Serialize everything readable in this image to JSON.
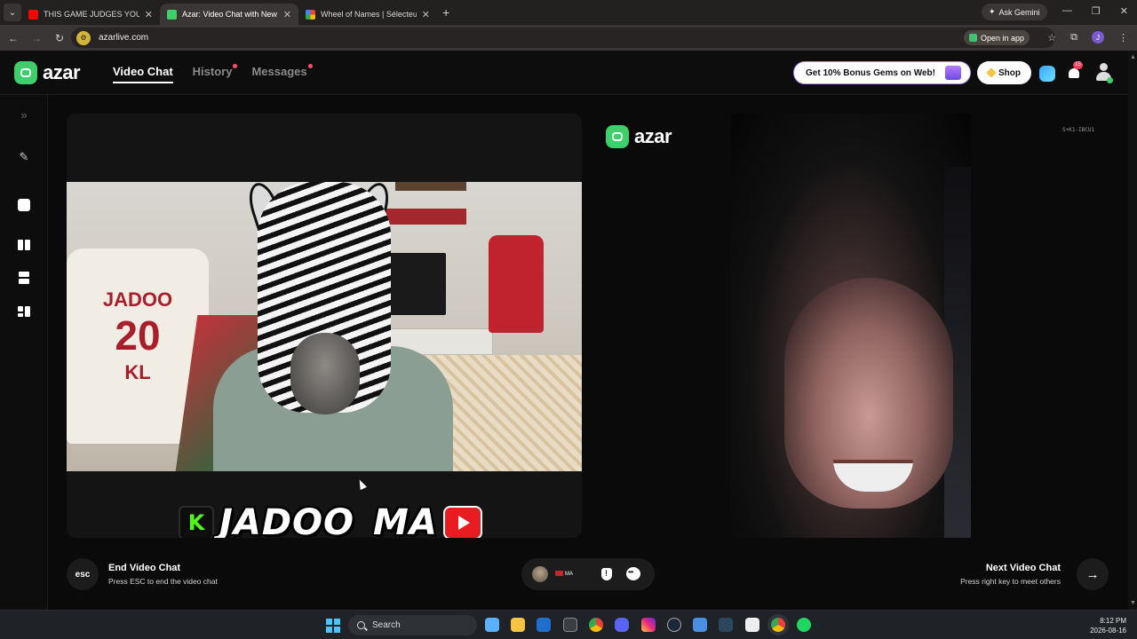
{
  "browser": {
    "tabs": [
      {
        "title": "THIS GAME JUDGES YOUR VOICE",
        "favicon_color": "#ff0000",
        "active": false
      },
      {
        "title": "Azar: Video Chat with New",
        "favicon_color": "#3ecf6c",
        "active": true
      },
      {
        "title": "Wheel of Names | Sélecteur de",
        "favicon_color": "#4285f4",
        "active": false
      }
    ],
    "new_tab": "+",
    "ask_gemini": "Ask Gemini",
    "url": "azarlive.com",
    "open_in_app": "Open in app",
    "profile_initial": "J"
  },
  "app": {
    "logo_text": "azar",
    "nav": [
      {
        "label": "Video Chat",
        "active": true,
        "dot": false
      },
      {
        "label": "History",
        "active": false,
        "dot": true
      },
      {
        "label": "Messages",
        "active": false,
        "dot": true
      }
    ],
    "promo_label": "Get 10% Bonus Gems on Web!",
    "shop_label": "Shop",
    "notification_count": "15",
    "accent_color": "#3ecf6c"
  },
  "left_rail": {
    "icons": [
      "expand-icon",
      "magic-wand-icon",
      "edit-icon",
      "layout-side-by-side-icon",
      "layout-stacked-icon",
      "layout-grid-icon"
    ]
  },
  "my_video": {
    "jersey_name": "JADOO",
    "jersey_number": "20",
    "jersey_initials": "KL",
    "stream_name": "JADOO_MA",
    "kick_letter": "K"
  },
  "partner": {
    "session_id": "S+K1-IBCU1",
    "watermark_logo_text": "azar"
  },
  "controls": {
    "esc_label": "esc",
    "end_title": "End Video Chat",
    "end_subtitle": "Press ESC to end the video chat",
    "partner_country": "MA",
    "next_title": "Next Video Chat",
    "next_subtitle": "Press right key to meet others",
    "next_arrow": "→"
  },
  "taskbar": {
    "search_placeholder": "Search",
    "time": "8:12 PM",
    "date": "2026-08-16",
    "apps": [
      "file-explorer-icon",
      "folder-icon",
      "outlook-icon",
      "store-icon",
      "chrome-icon",
      "discord-icon",
      "instagram-icon",
      "steam-icon",
      "winget-icon",
      "steam-client-icon",
      "cap-icon",
      "chrome-active-icon",
      "spotify-icon"
    ]
  }
}
